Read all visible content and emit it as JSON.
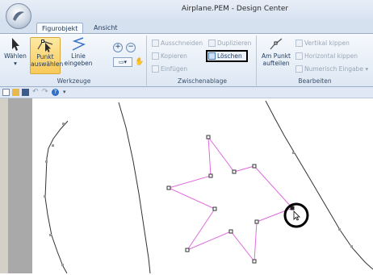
{
  "window": {
    "title": "Airplane.PEM - Design Center"
  },
  "tabs": [
    {
      "label": "Figurobjekt",
      "active": true
    },
    {
      "label": "Ansicht",
      "active": false
    }
  ],
  "ribbon": {
    "werkzeuge": {
      "label": "Werkzeuge",
      "waehlen": "Wählen",
      "punkt": "Punkt auswählen",
      "linie": "Linie eingeben"
    },
    "zwischenablage": {
      "label": "Zwischenablage",
      "ausschneiden": "Ausschneiden",
      "duplizieren": "Duplizieren",
      "kopieren": "Kopieren",
      "loeschen": "Löschen",
      "einfuegen": "Einfügen"
    },
    "bearbeiten": {
      "label": "Bearbeiten",
      "am_punkt": "Am Punkt aufteilen",
      "vertikal": "Vertikal kippen",
      "horizontal": "Horizontal kippen",
      "numerisch": "Numerisch Eingabe"
    }
  },
  "colors": {
    "shape": "#e06ae0",
    "selected_tool_bg": "#f8c95a",
    "ribbon_bg": "#dde7f3"
  },
  "icons": [
    "app-orb-icon",
    "select-arrow-icon",
    "select-point-icon",
    "line-input-icon",
    "zoom-in-icon",
    "zoom-out-icon",
    "scissors-icon",
    "duplicate-icon",
    "copy-icon",
    "delete-icon",
    "paste-icon",
    "split-point-icon",
    "flip-vertical-icon",
    "flip-horizontal-icon",
    "numeric-input-icon",
    "new-icon",
    "open-icon",
    "save-icon",
    "undo-icon",
    "redo-icon",
    "help-icon"
  ]
}
